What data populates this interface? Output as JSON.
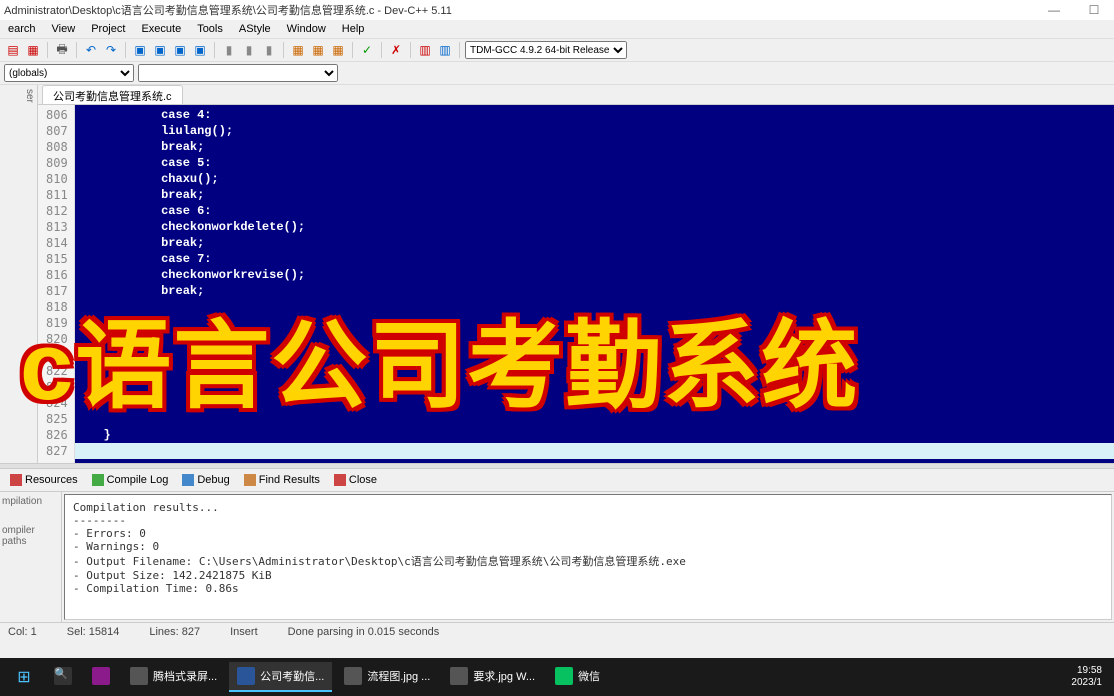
{
  "window": {
    "title": "Administrator\\Desktop\\c语言公司考勤信息管理系统\\公司考勤信息管理系统.c - Dev-C++ 5.11"
  },
  "menu": {
    "items": [
      "earch",
      "View",
      "Project",
      "Execute",
      "Tools",
      "AStyle",
      "Window",
      "Help"
    ]
  },
  "toolbar": {
    "compiler_select": "TDM-GCC 4.9.2 64-bit Release"
  },
  "second_row": {
    "scope_select": "(globals)"
  },
  "left_label": "ser",
  "tab": {
    "active": "公司考勤信息管理系统.c"
  },
  "code": {
    "lines": [
      {
        "n": 806,
        "t": "            case 4:"
      },
      {
        "n": 807,
        "t": "            liulang();"
      },
      {
        "n": 808,
        "t": "            break;"
      },
      {
        "n": 809,
        "t": "            case 5:"
      },
      {
        "n": 810,
        "t": "            chaxu();"
      },
      {
        "n": 811,
        "t": "            break;"
      },
      {
        "n": 812,
        "t": "            case 6:"
      },
      {
        "n": 813,
        "t": "            checkonworkdelete();"
      },
      {
        "n": 814,
        "t": "            break;"
      },
      {
        "n": 815,
        "t": "            case 7:"
      },
      {
        "n": 816,
        "t": "            checkonworkrevise();"
      },
      {
        "n": 817,
        "t": "            break;"
      },
      {
        "n": 818,
        "t": ""
      },
      {
        "n": 819,
        "t": ""
      },
      {
        "n": 820,
        "t": ""
      },
      {
        "n": 821,
        "t": ""
      },
      {
        "n": 822,
        "t": "        }"
      },
      {
        "n": 823,
        "t": ""
      },
      {
        "n": 824,
        "t": ""
      },
      {
        "n": 825,
        "t": ""
      },
      {
        "n": 826,
        "t": "    }"
      },
      {
        "n": 827,
        "t": "",
        "last": true
      }
    ]
  },
  "overlay": "c语言公司考勤系统",
  "bottom_tabs": {
    "resources": "Resources",
    "compile_log": "Compile Log",
    "debug": "Debug",
    "find_results": "Find Results",
    "close": "Close"
  },
  "bottom_left": {
    "label1": "mpilation",
    "label2": "ompiler paths"
  },
  "compile_log": {
    "header": "Compilation results...",
    "divider": "--------",
    "errors": "- Errors: 0",
    "warnings": "- Warnings: 0",
    "output_filename": "- Output Filename: C:\\Users\\Administrator\\Desktop\\c语言公司考勤信息管理系统\\公司考勤信息管理系统.exe",
    "output_size": "- Output Size: 142.2421875 KiB",
    "compilation_time": "- Compilation Time: 0.86s"
  },
  "status": {
    "col": "Col:   1",
    "sel": "Sel:  15814",
    "lines": "Lines:   827",
    "insert": "Insert",
    "parsing": "Done parsing in 0.015 seconds"
  },
  "taskbar": {
    "items": [
      {
        "label": "腾档式录屏..."
      },
      {
        "label": "公司考勤信..."
      },
      {
        "label": "流程图.jpg ..."
      },
      {
        "label": "要求.jpg  W..."
      },
      {
        "label": "微信"
      }
    ],
    "time": "19:58",
    "date": "2023/1"
  }
}
